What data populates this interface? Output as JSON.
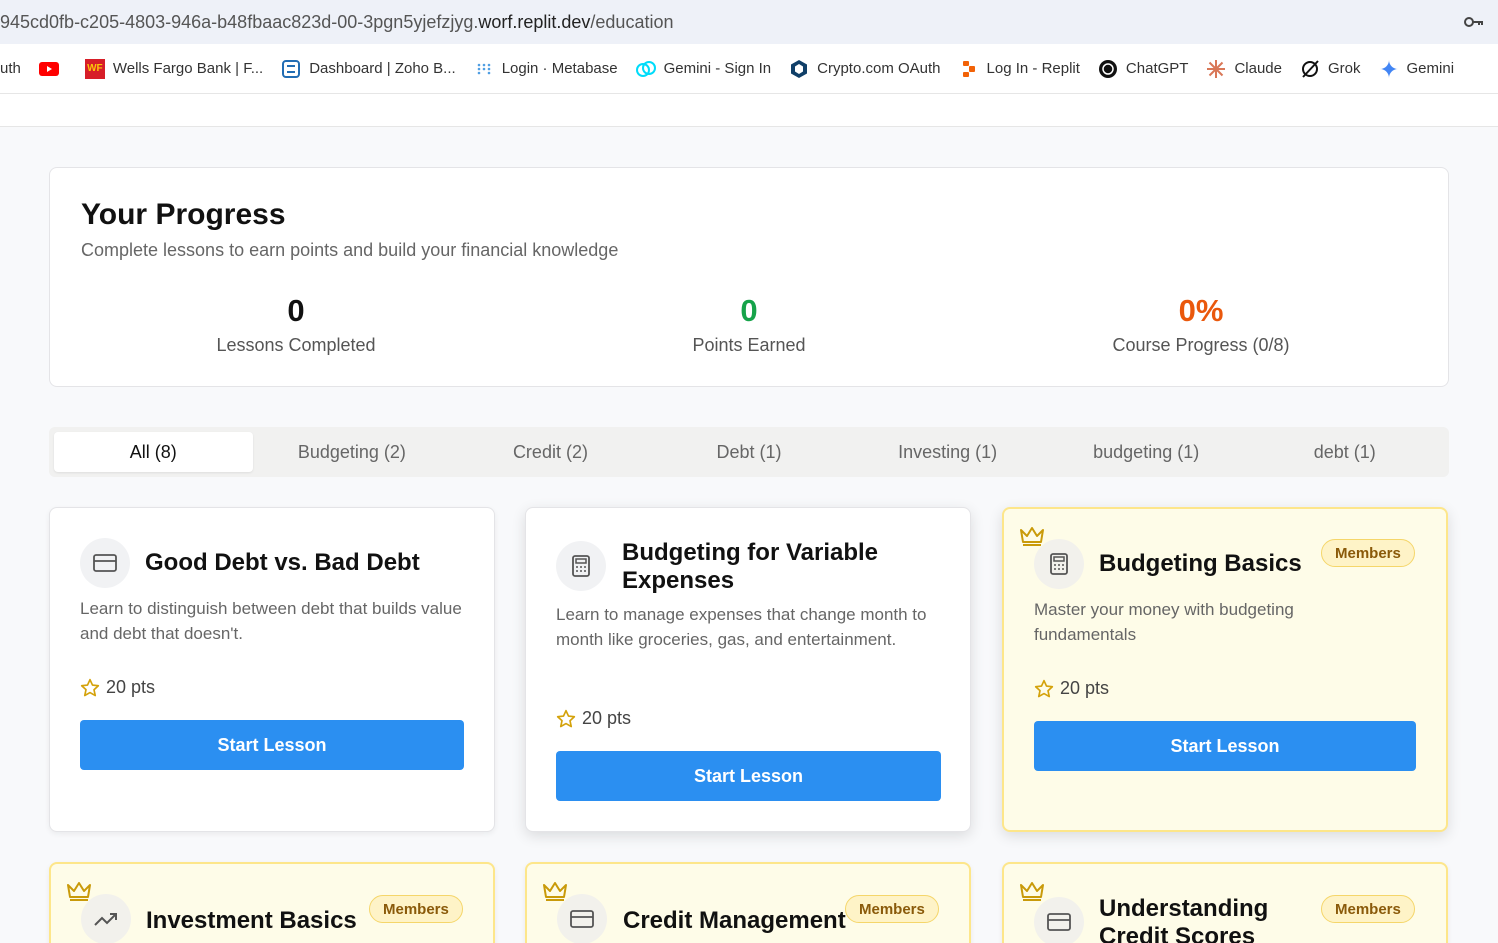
{
  "browser": {
    "url_prefix": "945cd0fb-c205-4803-946a-b48fbaac823d-00-3pgn5yjefzjyg.",
    "url_domain": "worf.replit.dev",
    "url_path": "/education",
    "bookmarks": [
      {
        "label": "uth",
        "icon": "none"
      },
      {
        "label": "",
        "icon": "youtube-icon"
      },
      {
        "label": "Wells Fargo Bank | F...",
        "icon": "wells-fargo-icon"
      },
      {
        "label": "Dashboard | Zoho B...",
        "icon": "zoho-icon"
      },
      {
        "label": "Login · Metabase",
        "icon": "metabase-icon"
      },
      {
        "label": "Gemini - Sign In",
        "icon": "gemini-exchange-icon"
      },
      {
        "label": "Crypto.com OAuth",
        "icon": "crypto-com-icon"
      },
      {
        "label": "Log In - Replit",
        "icon": "replit-icon"
      },
      {
        "label": "ChatGPT",
        "icon": "chatgpt-icon"
      },
      {
        "label": "Claude",
        "icon": "claude-icon"
      },
      {
        "label": "Grok",
        "icon": "grok-icon"
      },
      {
        "label": "Gemini",
        "icon": "gemini-icon"
      }
    ]
  },
  "progress": {
    "title": "Your Progress",
    "subtitle": "Complete lessons to earn points and build your financial knowledge",
    "stats": [
      {
        "value": "0",
        "label": "Lessons Completed",
        "color": "#111111"
      },
      {
        "value": "0",
        "label": "Points Earned",
        "color": "#16a34a"
      },
      {
        "value": "0%",
        "label": "Course Progress (0/8)",
        "color": "#ea580c"
      }
    ]
  },
  "tabs": [
    {
      "label": "All (8)",
      "active": true
    },
    {
      "label": "Budgeting (2)",
      "active": false
    },
    {
      "label": "Credit (2)",
      "active": false
    },
    {
      "label": "Debt (1)",
      "active": false
    },
    {
      "label": "Investing (1)",
      "active": false
    },
    {
      "label": "budgeting (1)",
      "active": false
    },
    {
      "label": "debt (1)",
      "active": false
    }
  ],
  "lessons": [
    {
      "title": "Good Debt vs. Bad Debt",
      "description": "Learn to distinguish between debt that builds value and debt that doesn't.",
      "points": "20 pts",
      "button": "Start Lesson",
      "icon": "credit-card-icon",
      "members": false
    },
    {
      "title": "Budgeting for Variable Expenses",
      "description": "Learn to manage expenses that change month to month like groceries, gas, and entertainment.",
      "points": "20 pts",
      "button": "Start Lesson",
      "icon": "calculator-icon",
      "members": false
    },
    {
      "title": "Budgeting Basics",
      "description": "Master your money with budgeting fundamentals",
      "points": "20 pts",
      "button": "Start Lesson",
      "icon": "calculator-icon",
      "members": true,
      "badge": "Members"
    },
    {
      "title": "Investment Basics",
      "icon": "trending-up-icon",
      "members": true,
      "badge": "Members"
    },
    {
      "title": "Credit Management",
      "icon": "credit-card-icon",
      "members": true,
      "badge": "Members"
    },
    {
      "title": "Understanding Credit Scores",
      "icon": "credit-card-icon",
      "members": true,
      "badge": "Members"
    }
  ],
  "colors": {
    "accent": "#2b8ff1",
    "member_bg": "#fefce8",
    "member_border": "#fde68a"
  }
}
